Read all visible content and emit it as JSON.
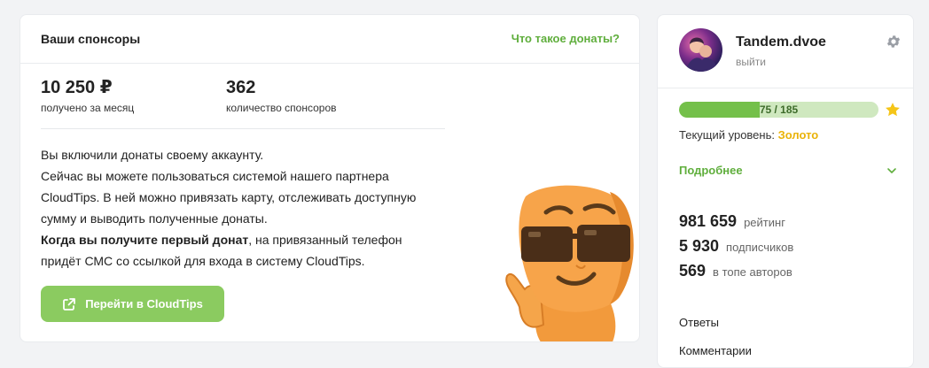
{
  "sponsors_card": {
    "title": "Ваши спонсоры",
    "what_link": "Что такое донаты?",
    "income_value": "10 250 ₽",
    "income_caption": "получено за месяц",
    "sponsors_value": "362",
    "sponsors_caption": "количество спонсоров",
    "line1": "Вы включили донаты своему аккаунту.",
    "line2": "Сейчас вы можете пользоваться системой нашего партнера CloudTips. В ней можно привязать карту, отслеживать доступную сумму и выводить полученные донаты.",
    "line3_bold": "Когда вы получите первый донат",
    "line3_rest": ", на привязанный телефон придёт СМС со ссылкой для входа в систему CloudTips.",
    "button_label": "Перейти в CloudTips",
    "button_icon": "external-link-icon",
    "accent_color": "#5fae3c",
    "button_color": "#8bcb60"
  },
  "profile": {
    "username": "Tandem.dvoe",
    "logout": "выйти",
    "settings_icon": "gear-icon",
    "progress_label": "75 / 185",
    "progress_fraction": 0.405,
    "level_label": "Текущий уровень:",
    "level_value": "Золото",
    "details": "Подробнее",
    "rating_value": "981 659",
    "rating_label": "рейтинг",
    "subscribers_value": "5 930",
    "subscribers_label": "подписчиков",
    "top_value": "569",
    "top_label": "в топе авторов",
    "links": [
      "Ответы",
      "Комментарии"
    ],
    "gold_color": "#eab308"
  }
}
